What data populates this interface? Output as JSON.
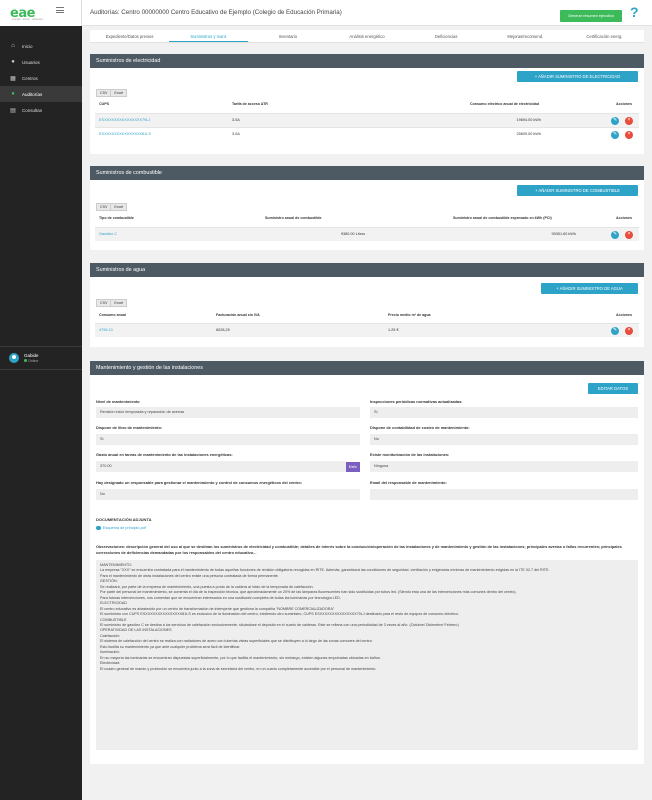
{
  "app": {
    "logo_text": "eae",
    "logo_sub": "energía · ahorro · eficiencia"
  },
  "sidebar": {
    "items": [
      {
        "icon": "home-icon",
        "label": "Inicio"
      },
      {
        "icon": "users-icon",
        "label": "Usuarios"
      },
      {
        "icon": "building-icon",
        "label": "Centros"
      },
      {
        "icon": "bulb-icon",
        "label": "Auditorías"
      },
      {
        "icon": "list-icon",
        "label": "Consultas"
      }
    ],
    "user": {
      "name": "Gabide",
      "status": "Online"
    }
  },
  "header": {
    "title": "Auditorías: Centro 00000000 Centro Educativo de Ejemplo (Colegio de Educación Primaria)",
    "generate_button": "Generar resumen ejecutivo",
    "help": "?"
  },
  "tabs": [
    "Expediente/Datos previos",
    "Suministros y mant.",
    "Inventario",
    "Análisis energético",
    "Deficiencias",
    "Mejoras/recomend.",
    "Certificación energ."
  ],
  "export": {
    "csv": "CSV",
    "excel": "Excel"
  },
  "electricidad": {
    "title": "Suministros de electricidad",
    "add_button": "+ AÑADIR SUMINISTRO DE ELECTRICIDAD",
    "headers": [
      "CUPS",
      "Tarifa de acceso ATR",
      "Consumo eléctrico anual de electricidad",
      "Acciones"
    ],
    "rows": [
      {
        "cups": "ESXXXXXXXXXXXXXXX79LJ",
        "tarifa": "3.0A",
        "consumo": "19694.00 kWh"
      },
      {
        "cups": "ESXXXXXXXXXXXXXXX81LS",
        "tarifa": "3.0A",
        "consumo": "25609.00 kWh"
      }
    ]
  },
  "combustible": {
    "title": "Suministros de combustible",
    "add_button": "+ AÑADIR SUMINISTRO DE COMBUSTIBLE",
    "headers": [
      "Tipo de combustible",
      "Suministro anual de combustible",
      "Suministro anual de combustible expresado en kWh (PCI)",
      "Acciones"
    ],
    "rows": [
      {
        "tipo": "Gasóleo C",
        "suministro": "9380.00 Litros",
        "kwh": "95351.60 kWh"
      }
    ]
  },
  "agua": {
    "title": "Suministros de agua",
    "add_button": "+ AÑADIR SUMINISTRO DE AGUA",
    "headers": [
      "Consumo anual",
      "Facturación anual sin IVA",
      "Precio medio m³ de agua",
      "Acciones"
    ],
    "rows": [
      {
        "consumo": "4796.10",
        "facturacion": "6028,25",
        "precio": "1.25 €"
      }
    ]
  },
  "mantenimiento": {
    "title": "Mantenimiento y gestión de las instalaciones",
    "edit_button": "EDITAR DATOS",
    "fields": [
      {
        "label": "Nivel de mantenimiento",
        "value": "Revisión inicio temporada y reparación de averías"
      },
      {
        "label": "Inspecciones periódicas normativas actualizadas:",
        "value": "Sí"
      },
      {
        "label": "Dispone de libro de mantenimiento:",
        "value": "Sí"
      },
      {
        "label": "Dispone de contabilidad de costes de mantenimiento:",
        "value": "No"
      },
      {
        "label": "Gasto anual en tareas de mantenimiento de las instalaciones energéticas:",
        "value": "370.00",
        "unit": "€/año"
      },
      {
        "label": "Existe monitorización de las instalaciones:",
        "value": "Ninguna"
      },
      {
        "label": "Hay designado un responsable para gestionar el mantenimiento y control de consumos energéticos del centro:",
        "value": "No"
      },
      {
        "label": "Email del responsable de mantenimiento:",
        "value": ""
      }
    ],
    "doc_title": "DOCUMENTACIÓN ADJUNTA",
    "doc_link": "Esquema de principio.pdf",
    "obs_label": "Observaciones: descripción general del uso al que se destinan los suministros de electricidad y combustible; detalles de interés sobre la conducción/operación de las instalaciones y de mantenimiento y gestión de las instalaciones; principales averías o fallos recurrentes; principales correcciones de deficiencias demandadas por los responsables del centro educativo...",
    "obs_lines": [
      "MANTENIMIENTO:",
      "La empresa \"XXX\" se encuentra contratada para el mantenimiento de todas aquellas funciones de revisión obligatoria recogidas en RITE. Además, garantizará las condiciones de seguridad, ventilación y exigencias mínimas de mantenimiento exigidas en la ITE 02.7 del RITE.",
      "Para el mantenimiento de otras instalaciones del centro existe una persona contratada de forma permanente.",
      "GESTIÓN:",
      "Se realizará, por parte de la empresa de mantenimiento, una puesta a punto de la caldera al inicio de la temporada de calefacción.",
      "Por parte del personal de mantenimiento, se comenta el día de la inspección técnica, que aproximadamente un 20% de las lámparas fluorescentes han sido sustituidas por tubos led. (Siendo esta una de las intervenciones más comunes dentro del centro).",
      "Para futuras intervenciones, nos comentan que se encuentran interesados en una sustitución completa de todas las luminarias por tecnología LED.",
      "ELECTRICIDAD",
      "El centro educativo es abastecido por un centro de transformación de intemperie que gestiona la compañía \"NOMBRE COMERCIALIZADORA\"",
      "El suministro con CUPS ESXXXXXXXXXXXXXXX81LS es exclusivo de la iluminación del centro, existiendo otro suministro, CUPS ESXXXXXXXXXXXXXXX79LJ destinado para el resto de equipos de consumo eléctrico.",
      "COMBUSTIBLE",
      "El suministro de gasóleo C se destina a los servicios de calefacción exclusivamente, situándose el depósito en el cuarto de calderas. Este se rellena con una periodicidad de 3 veces al año. (Octubre/ Diciembre/ Febrero)",
      "OPERATIVIDAD DE LAS INSTALACIONES",
      "Calefacción:",
      "El sistema de calefacción del centro se realiza con radiadores de acero con tuberías vistas superficiales que se distribuyen a lo largo de las zonas comunes del centro.",
      "Esto facilita su mantenimiento ya que ante cualquier problema será fácil de identificar.",
      "Iluminación:",
      "En su mayoría las luminarias se encuentran dispuestas superficialmente, por lo que facilita el mantenimiento, sin embargo, existen algunas empotradas ubicadas en baños.",
      "Electricidad:",
      "El cuadro general de mando y protección se encuentra junto a la zona de secretaría del centro, en un cuarto completamente accesible por el personal de mantenimiento."
    ]
  },
  "colors": {
    "accent": "#2ea3c8",
    "green": "#3dba5a",
    "panel_header": "#4d5a64",
    "delete": "#e74c3c",
    "sidebar": "#232323"
  }
}
